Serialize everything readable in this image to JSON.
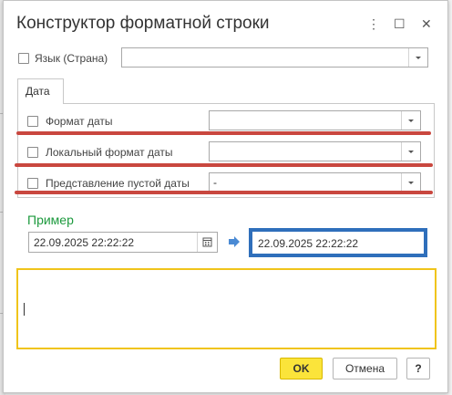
{
  "window": {
    "title": "Конструктор форматной строки"
  },
  "titlebar": {
    "menu_glyph": "⋮",
    "maximize_glyph": "☐",
    "close_glyph": "✕"
  },
  "language": {
    "label": "Язык (Страна)",
    "value": ""
  },
  "tabs": [
    {
      "label": "Дата"
    }
  ],
  "fields": [
    {
      "label": "Формат даты",
      "value": ""
    },
    {
      "label": "Локальный формат даты",
      "value": ""
    },
    {
      "label": "Представление пустой даты",
      "value": "-"
    }
  ],
  "example": {
    "heading": "Пример",
    "input_value": "22.09.2025 22:22:22",
    "result_value": "22.09.2025 22:22:22"
  },
  "format_text": "",
  "buttons": {
    "ok": "OK",
    "cancel": "Отмена",
    "help": "?"
  },
  "colors": {
    "highlight_red": "#c9473f",
    "accent_green": "#1d9a3e",
    "focus_blue": "#2f6fbb",
    "format_border": "#f0c41a",
    "ok_button": "#fbe43a"
  }
}
